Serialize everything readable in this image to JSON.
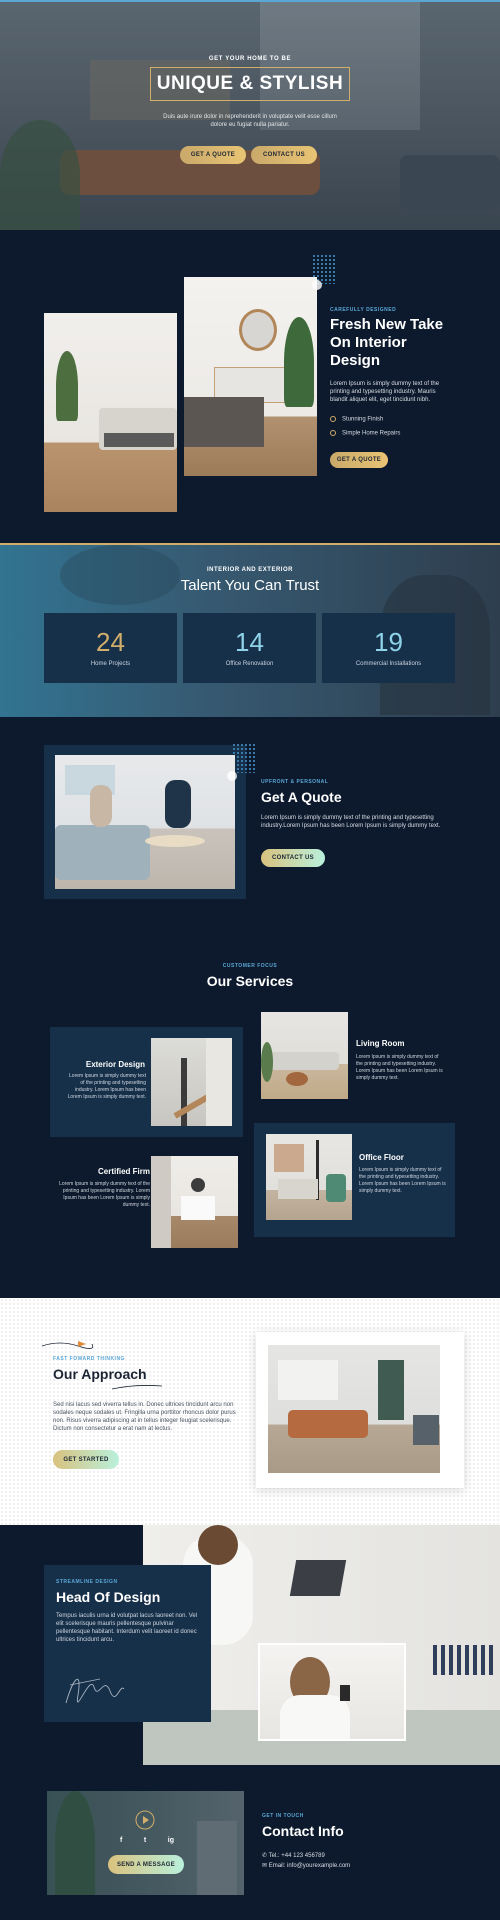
{
  "hero": {
    "kicker": "GET YOUR HOME TO BE",
    "title": "UNIQUE & STYLISH",
    "text": "Duis aute irure dolor in reprehenderit in voluptate velit esse cillum dolore eu fugiat nulla pariatur.",
    "quote_button": "GET A QUOTE",
    "contact_button": "CONTACT US"
  },
  "fresh": {
    "kicker": "CAREFULLY DESIGNED",
    "title": "Fresh New Take On Interior Design",
    "text": "Lorem Ipsum is simply dummy text of the printing and typesetting industry. Mauris blandit aliquet elit, eget tincidunt nibh.",
    "items": [
      "Stunning Finish",
      "Simple Home Repairs"
    ],
    "button": "GET A QUOTE"
  },
  "talent": {
    "kicker": "INTERIOR AND EXTERIOR",
    "title": "Talent You Can Trust",
    "stats": [
      {
        "value": "24",
        "label": "Home Projects"
      },
      {
        "value": "14",
        "label": "Office Renovation"
      },
      {
        "value": "19",
        "label": "Commercial Installations"
      }
    ]
  },
  "quote": {
    "kicker": "UPFRONT & PERSONAL",
    "title": "Get A Quote",
    "text": "Lorem Ipsum is simply dummy text of the printing and typesetting industry.Lorem Ipsum has been Lorem Ipsum is simply dummy text.",
    "button": "CONTACT US"
  },
  "services": {
    "kicker": "CUSTOMER FOCUS",
    "title": "Our Services",
    "items": [
      {
        "title": "Exterior Design",
        "text": "Lorem Ipsum is simply dummy text of the printing and typesetting industry. Lorem Ipsum has been Lorem Ipsum is simply dummy text."
      },
      {
        "title": "Living Room",
        "text": "Lorem Ipsum is simply dummy text of the printing and typesetting industry. Lorem Ipsum has been Lorem Ipsum is simply dummy text."
      },
      {
        "title": "Certified Firm",
        "text": "Lorem Ipsum is simply dummy text of the printing and typesetting industry. Lorem Ipsum has been Lorem Ipsum is simply dummy text."
      },
      {
        "title": "Office Floor",
        "text": "Lorem Ipsum is simply dummy text of the printing and typesetting industry. Lorem Ipsum has been Lorem Ipsum is simply dummy text."
      }
    ]
  },
  "approach": {
    "kicker": "FAST FOWARD THINKING",
    "title": "Our Approach",
    "text": "Sed nisi lacus sed viverra tellus in. Donec ultrices tincidunt arcu non sodales neque sodales ut. Fringilla urna porttitor rhoncus dolor purus non. Risus viverra adipiscing at in tellus integer feugiat scelerisque. Dictum non consectetur a erat nam at lectus.",
    "button": "GET STARTED"
  },
  "head": {
    "kicker": "STREAMLINE DESIGN",
    "title": "Head Of Design",
    "text": "Tempus iaculis urna id volutpat lacus laoreet non. Vel elit scelerisque mauris pellentesque pulvinar pellentesque habitant. Interdum velit laoreet id donec ultrices tincidunt arcu."
  },
  "contact": {
    "kicker": "GET IN TOUCH",
    "title": "Contact Info",
    "phone": "Tel.: +44 123 456789",
    "email": "Email: info@yourexample.com",
    "button": "SEND A MESSAGE",
    "socials": [
      "f",
      "t",
      "ig"
    ]
  },
  "colors": {
    "navy": "#0d1a2d",
    "card": "#17304a",
    "gold": "#d2ad6b",
    "blue": "#5aa7d6"
  }
}
